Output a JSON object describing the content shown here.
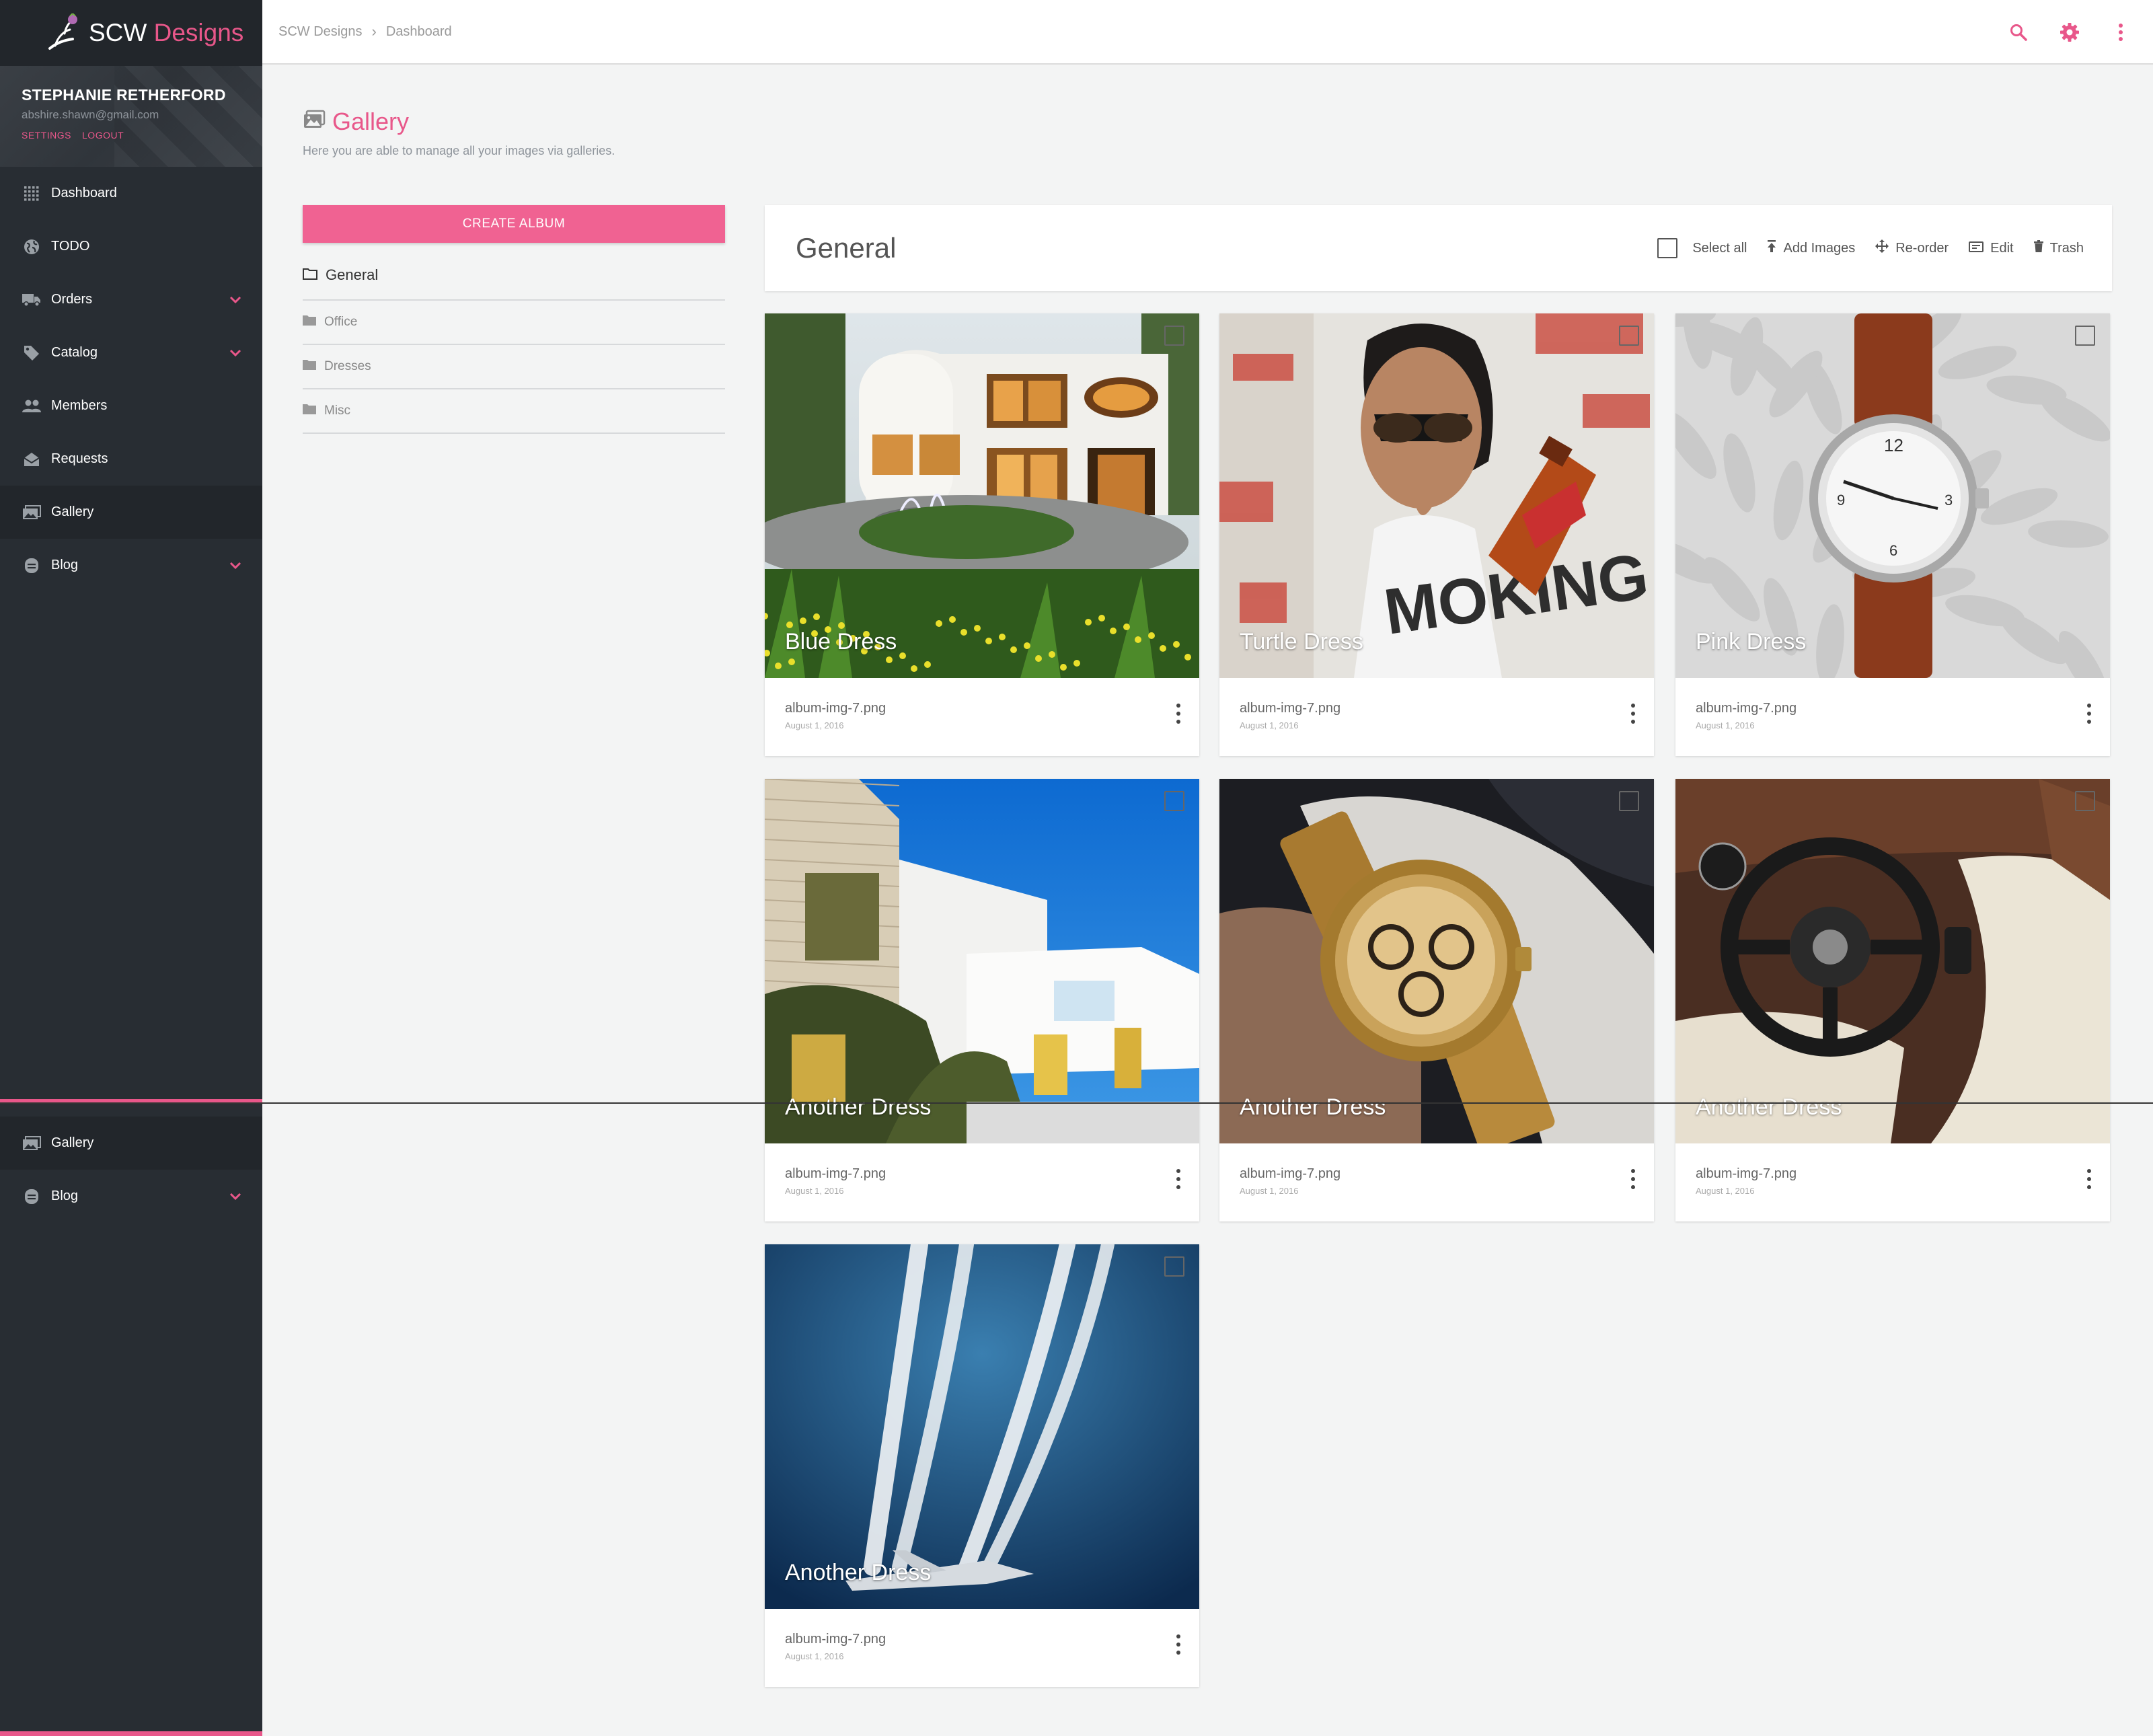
{
  "brand": {
    "name_main": "SCW ",
    "name_accent": "Designs"
  },
  "user": {
    "name": "STEPHANIE RETHERFORD",
    "email": "abshire.shawn@gmail.com",
    "settings": "SETTINGS",
    "logout": "LOGOUT"
  },
  "nav": [
    {
      "label": "Dashboard",
      "icon": "grid-icon",
      "expand": false,
      "active": false
    },
    {
      "label": "TODO",
      "icon": "globe-icon",
      "expand": false,
      "active": false
    },
    {
      "label": "Orders",
      "icon": "truck-icon",
      "expand": true,
      "active": false
    },
    {
      "label": "Catalog",
      "icon": "tag-icon",
      "expand": true,
      "active": false
    },
    {
      "label": "Members",
      "icon": "users-icon",
      "expand": false,
      "active": false
    },
    {
      "label": "Requests",
      "icon": "envelope-open-icon",
      "expand": false,
      "active": false
    },
    {
      "label": "Gallery",
      "icon": "images-icon",
      "expand": false,
      "active": true
    },
    {
      "label": "Blog",
      "icon": "document-icon",
      "expand": true,
      "active": false
    }
  ],
  "nav_duplicate": [
    {
      "label": "Gallery",
      "icon": "images-icon"
    },
    {
      "label": "Blog",
      "icon": "document-icon"
    }
  ],
  "breadcrumb": [
    "SCW Designs",
    "Dashboard"
  ],
  "page": {
    "title": "Gallery",
    "subtitle": "Here you are able to manage all your images via galleries."
  },
  "albums": {
    "create_label": "CREATE ALBUM",
    "current": "General",
    "items": [
      "Office",
      "Dresses",
      "Misc"
    ]
  },
  "panel": {
    "title": "General",
    "select_all": "Select all",
    "add_images": "Add Images",
    "reorder": "Re-order",
    "edit": "Edit",
    "trash": "Trash"
  },
  "cards": [
    {
      "caption": "Blue Dress",
      "file": "album-img-7.png",
      "date": "August 1, 2016",
      "scene": "mansion"
    },
    {
      "caption": "Turtle Dress",
      "file": "album-img-7.png",
      "date": "August 1, 2016",
      "scene": "woman"
    },
    {
      "caption": "Pink Dress",
      "file": "album-img-7.png",
      "date": "August 1, 2016",
      "scene": "watch"
    },
    {
      "caption": "Another Dress",
      "file": "album-img-7.png",
      "date": "August 1, 2016",
      "scene": "modern-house"
    },
    {
      "caption": "Another Dress",
      "file": "album-img-7.png",
      "date": "August 1, 2016",
      "scene": "gold-watch"
    },
    {
      "caption": "Another Dress",
      "file": "album-img-7.png",
      "date": "August 1, 2016",
      "scene": "car-interior"
    },
    {
      "caption": "Another Dress",
      "file": "album-img-7.png",
      "date": "August 1, 2016",
      "scene": "jet"
    }
  ],
  "colors": {
    "accent": "#e8578a",
    "sidebar": "#282d33",
    "button": "#f06292"
  }
}
